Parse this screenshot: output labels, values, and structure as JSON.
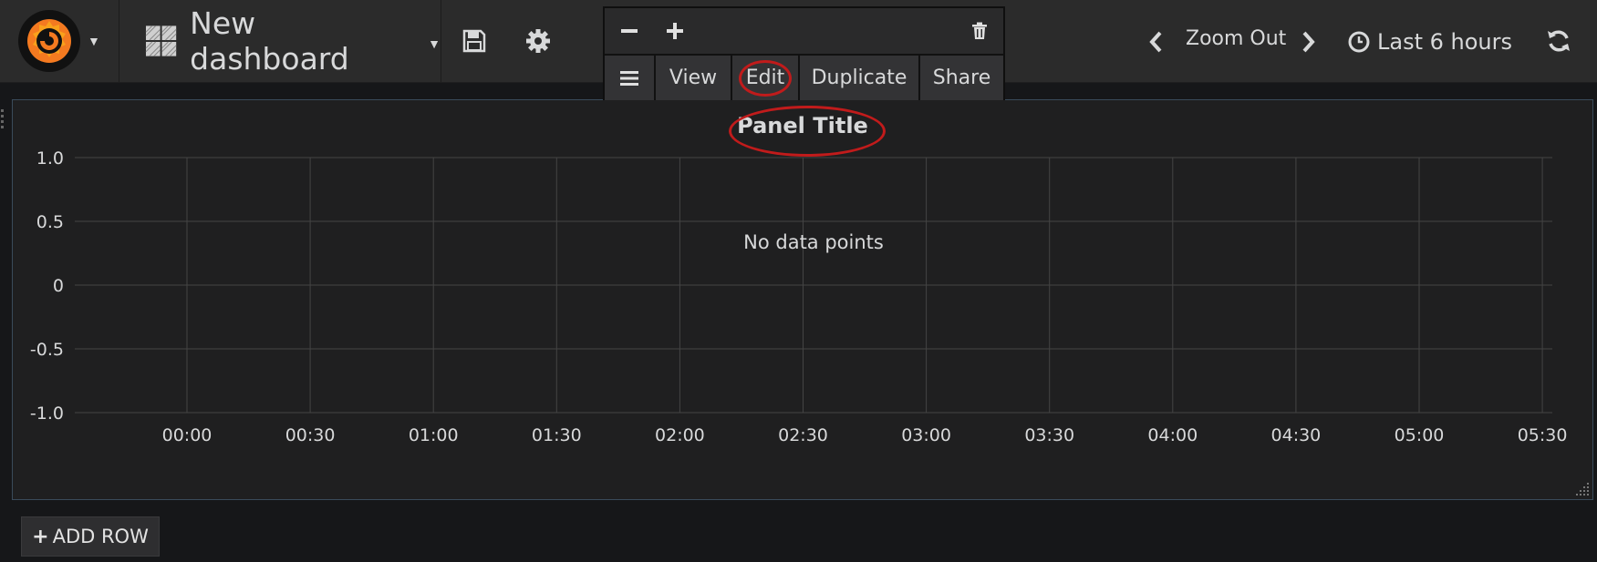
{
  "navbar": {
    "dashboard_title": "New dashboard",
    "zoom_out_label": "Zoom Out",
    "time_range_label": "Last 6 hours"
  },
  "panel_menu": {
    "view_label": "View",
    "edit_label": "Edit",
    "duplicate_label": "Duplicate",
    "share_label": "Share"
  },
  "panel": {
    "title": "Panel Title",
    "empty_message": "No data points"
  },
  "add_row": {
    "label": "ADD ROW"
  },
  "icons": {
    "logo": "grafana-logo-icon",
    "dashboard": "dashboard-grid-icon",
    "save": "save-icon",
    "settings": "gear-icon",
    "prev": "chevron-left-icon",
    "next": "chevron-right-icon",
    "clock": "clock-icon",
    "refresh": "refresh-icon",
    "menu": "hamburger-icon",
    "minus": "minus-icon",
    "plus": "plus-icon",
    "trash": "trash-icon"
  },
  "colors": {
    "background": "#161719",
    "navbar": "#2b2b2b",
    "panel": "#1f1f20",
    "annotation": "#c11b1b",
    "logo_orange": "#f47a20"
  },
  "chart_data": {
    "type": "line",
    "title": "Panel Title",
    "x": [
      "00:00",
      "00:30",
      "01:00",
      "01:30",
      "02:00",
      "02:30",
      "03:00",
      "03:30",
      "04:00",
      "04:30",
      "05:00",
      "05:30"
    ],
    "y_ticks": [
      "1.0",
      "0.5",
      "0",
      "-0.5",
      "-1.0"
    ],
    "ylim": [
      -1.0,
      1.0
    ],
    "series": [],
    "annotation": "No data points",
    "grid": true
  }
}
